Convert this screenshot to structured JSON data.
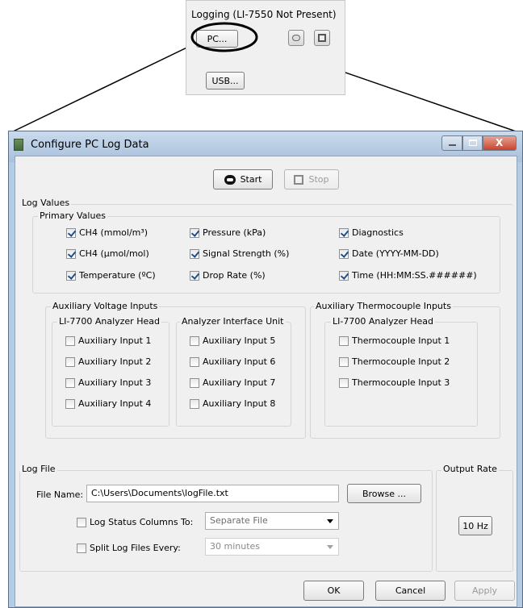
{
  "logging_panel": {
    "title": "Logging (LI-7550 Not Present)",
    "pc_button": "PC...",
    "usb_button": "USB..."
  },
  "window": {
    "title": "Configure PC Log Data",
    "start_label": "Start",
    "stop_label": "Stop"
  },
  "log_values": {
    "title": "Log Values",
    "primary": {
      "title": "Primary Values",
      "items": [
        {
          "label": "CH4 (mmol/m³)",
          "checked": true
        },
        {
          "label": "CH4 (µmol/mol)",
          "checked": true
        },
        {
          "label": "Temperature (ºC)",
          "checked": true
        },
        {
          "label": "Pressure (kPa)",
          "checked": true
        },
        {
          "label": "Signal Strength (%)",
          "checked": true
        },
        {
          "label": "Drop Rate (%)",
          "checked": true
        },
        {
          "label": "Diagnostics",
          "checked": true
        },
        {
          "label": "Date (YYYY-MM-DD)",
          "checked": true
        },
        {
          "label": "Time (HH:MM:SS.######)",
          "checked": true
        }
      ]
    },
    "aux_voltage": {
      "title": "Auxiliary Voltage Inputs",
      "head_title": "LI-7700 Analyzer Head",
      "head_items": [
        "Auxiliary Input 1",
        "Auxiliary Input 2",
        "Auxiliary Input 3",
        "Auxiliary Input 4"
      ],
      "aiu_title": "Analyzer Interface Unit",
      "aiu_items": [
        "Auxiliary Input 5",
        "Auxiliary Input 6",
        "Auxiliary Input 7",
        "Auxiliary Input 8"
      ]
    },
    "aux_thermo": {
      "title": "Auxiliary Thermocouple Inputs",
      "head_title": "LI-7700 Analyzer Head",
      "items": [
        "Thermocouple Input 1",
        "Thermocouple Input 2",
        "Thermocouple Input 3"
      ]
    }
  },
  "log_file": {
    "title": "Log File",
    "file_name_label": "File Name:",
    "file_name_value": "C:\\Users\\Documents\\logFile.txt",
    "browse_label": "Browse ...",
    "status_columns_label": "Log Status Columns To:",
    "status_columns_value": "Separate File",
    "split_label": "Split Log Files Every:",
    "split_value": "30 minutes"
  },
  "output_rate": {
    "title": "Output Rate",
    "value": "10 Hz"
  },
  "footer": {
    "ok": "OK",
    "cancel": "Cancel",
    "apply": "Apply"
  }
}
